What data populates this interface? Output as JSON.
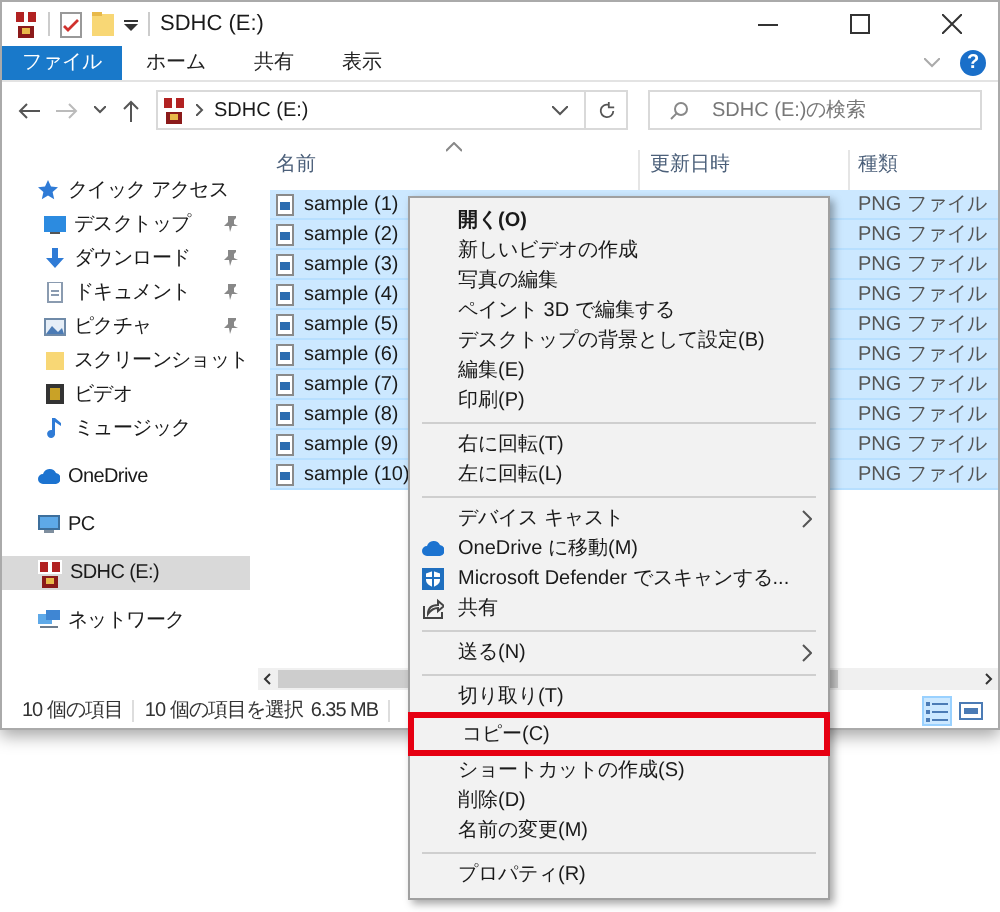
{
  "window": {
    "title": "SDHC (E:)"
  },
  "ribbon": {
    "tabs": [
      {
        "label": "ファイル",
        "selected": true
      },
      {
        "label": "ホーム",
        "selected": false
      },
      {
        "label": "共有",
        "selected": false
      },
      {
        "label": "表示",
        "selected": false
      }
    ],
    "help": "?"
  },
  "address_bar": {
    "path": "SDHC (E:)",
    "search_placeholder": "SDHC (E:)の検索"
  },
  "navigation": [
    {
      "label": "クイック アクセス",
      "pinned": false,
      "selected": false,
      "children": [
        {
          "label": "デスクトップ",
          "pinned": true,
          "selected": false
        },
        {
          "label": "ダウンロード",
          "pinned": true,
          "selected": false
        },
        {
          "label": "ドキュメント",
          "pinned": true,
          "selected": false
        },
        {
          "label": "ピクチャ",
          "pinned": true,
          "selected": false
        },
        {
          "label": "スクリーンショット",
          "pinned": false,
          "selected": false
        },
        {
          "label": "ビデオ",
          "pinned": false,
          "selected": false
        },
        {
          "label": "ミュージック",
          "pinned": false,
          "selected": false
        }
      ]
    },
    {
      "label": "OneDrive",
      "pinned": false,
      "selected": false
    },
    {
      "label": "PC",
      "pinned": false,
      "selected": false
    },
    {
      "label": "SDHC (E:)",
      "pinned": false,
      "selected": true
    },
    {
      "label": "ネットワーク",
      "pinned": false,
      "selected": false
    }
  ],
  "file_list": {
    "columns": [
      "名前",
      "更新日時",
      "種類"
    ],
    "rows": [
      {
        "name": "sample (1)",
        "type": "PNG ファイル",
        "selected": true
      },
      {
        "name": "sample (2)",
        "type": "PNG ファイル",
        "selected": true
      },
      {
        "name": "sample (3)",
        "type": "PNG ファイル",
        "selected": true
      },
      {
        "name": "sample (4)",
        "type": "PNG ファイル",
        "selected": true
      },
      {
        "name": "sample (5)",
        "type": "PNG ファイル",
        "selected": true
      },
      {
        "name": "sample (6)",
        "type": "PNG ファイル",
        "selected": true
      },
      {
        "name": "sample (7)",
        "type": "PNG ファイル",
        "selected": true
      },
      {
        "name": "sample (8)",
        "type": "PNG ファイル",
        "selected": true
      },
      {
        "name": "sample (9)",
        "type": "PNG ファイル",
        "selected": true
      },
      {
        "name": "sample (10)",
        "type": "PNG ファイル",
        "selected": true
      }
    ]
  },
  "status_bar": {
    "item_count": "10 個の項目",
    "selection": "10 個の項目を選択",
    "size": "6.35 MB",
    "views": [
      {
        "kind": "details",
        "selected": true
      },
      {
        "kind": "large_icons",
        "selected": false
      }
    ]
  },
  "context_menu": [
    {
      "kind": "item",
      "label": "開く(O)",
      "default": true,
      "submenu": false,
      "highlighted": false
    },
    {
      "kind": "item",
      "label": "新しいビデオの作成",
      "default": false,
      "submenu": false,
      "highlighted": false
    },
    {
      "kind": "item",
      "label": "写真の編集",
      "default": false,
      "submenu": false,
      "highlighted": false
    },
    {
      "kind": "item",
      "label": "ペイント 3D で編集する",
      "default": false,
      "submenu": false,
      "highlighted": false
    },
    {
      "kind": "item",
      "label": "デスクトップの背景として設定(B)",
      "default": false,
      "submenu": false,
      "highlighted": false
    },
    {
      "kind": "item",
      "label": "編集(E)",
      "default": false,
      "submenu": false,
      "highlighted": false
    },
    {
      "kind": "item",
      "label": "印刷(P)",
      "default": false,
      "submenu": false,
      "highlighted": false
    },
    {
      "kind": "separator"
    },
    {
      "kind": "item",
      "label": "右に回転(T)",
      "default": false,
      "submenu": false,
      "highlighted": false
    },
    {
      "kind": "item",
      "label": "左に回転(L)",
      "default": false,
      "submenu": false,
      "highlighted": false
    },
    {
      "kind": "separator"
    },
    {
      "kind": "item",
      "label": "デバイス キャスト",
      "default": false,
      "submenu": true,
      "highlighted": false
    },
    {
      "kind": "item",
      "label": "OneDrive に移動(M)",
      "default": false,
      "submenu": false,
      "highlighted": false
    },
    {
      "kind": "item",
      "label": "Microsoft Defender でスキャンする...",
      "default": false,
      "submenu": false,
      "highlighted": false
    },
    {
      "kind": "item",
      "label": "共有",
      "default": false,
      "submenu": false,
      "highlighted": false
    },
    {
      "kind": "separator"
    },
    {
      "kind": "item",
      "label": "送る(N)",
      "default": false,
      "submenu": true,
      "highlighted": false
    },
    {
      "kind": "separator"
    },
    {
      "kind": "item",
      "label": "切り取り(T)",
      "default": false,
      "submenu": false,
      "highlighted": false
    },
    {
      "kind": "item",
      "label": "コピー(C)",
      "default": false,
      "submenu": false,
      "highlighted": true
    },
    {
      "kind": "item",
      "label": "ショートカットの作成(S)",
      "default": false,
      "submenu": false,
      "highlighted": false
    },
    {
      "kind": "item",
      "label": "削除(D)",
      "default": false,
      "submenu": false,
      "highlighted": false
    },
    {
      "kind": "item",
      "label": "名前の変更(M)",
      "default": false,
      "submenu": false,
      "highlighted": false
    },
    {
      "kind": "separator"
    },
    {
      "kind": "item",
      "label": "プロパティ(R)",
      "default": false,
      "submenu": false,
      "highlighted": false
    }
  ]
}
